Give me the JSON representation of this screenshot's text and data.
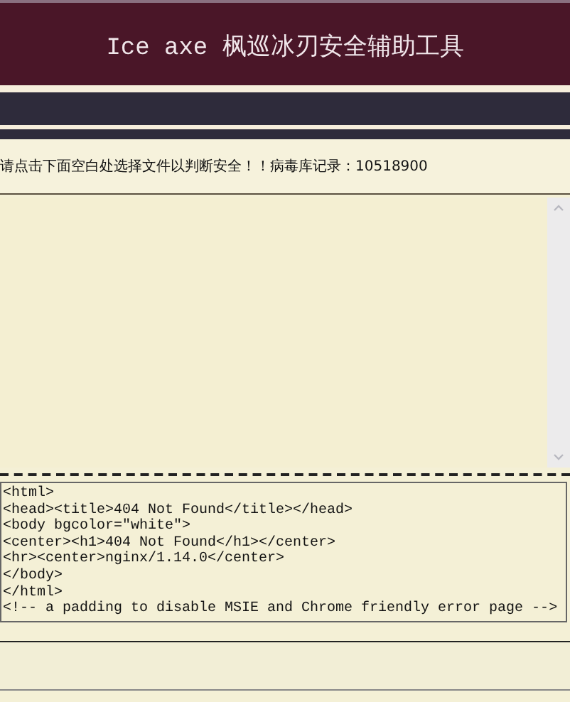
{
  "header": {
    "title": "Ice axe 枫巡冰刃安全辅助工具"
  },
  "info": {
    "text": "请点击下面空白处选择文件以判断安全！！病毒库记录：10518900"
  },
  "result": {
    "lines": [
      "<html>",
      "<head><title>404 Not Found</title></head>",
      "<body bgcolor=\"white\">",
      "<center><h1>404 Not Found</h1></center>",
      "<hr><center>nginx/1.14.0</center>",
      "</body>",
      "</html>",
      "<!-- a padding to disable MSIE and Chrome friendly error page -->"
    ]
  }
}
